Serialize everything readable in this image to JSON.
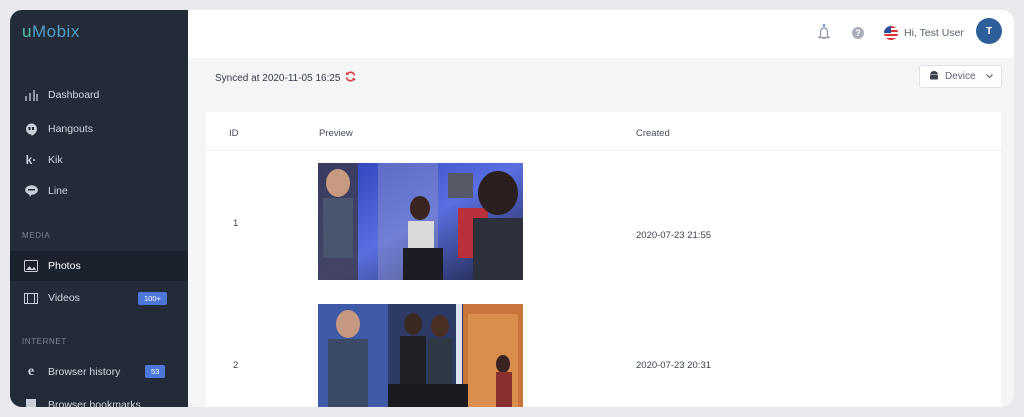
{
  "app": {
    "logo_prefix": "u",
    "logo_rest": "Mobix"
  },
  "sidebar": {
    "items": [
      {
        "label": "Dashboard",
        "icon": "bar-chart-icon"
      },
      {
        "label": "Hangouts",
        "icon": "hangouts-icon"
      },
      {
        "label": "Kik",
        "icon": "kik-icon"
      },
      {
        "label": "Line",
        "icon": "line-icon"
      },
      {
        "label": "Photos",
        "icon": "photos-icon",
        "active": true
      },
      {
        "label": "Videos",
        "icon": "film-icon",
        "badge": "100+"
      },
      {
        "label": "Browser history",
        "icon": "browser-icon",
        "badge": "53"
      },
      {
        "label": "Browser bookmarks",
        "icon": "bookmark-icon"
      }
    ],
    "sections": {
      "media": "MEDIA",
      "internet": "INTERNET"
    }
  },
  "header": {
    "greeting": "Hi, Test User",
    "avatar_initial": "T"
  },
  "sync": {
    "text": "Synced at 2020-11-05 16:25"
  },
  "device_select": {
    "label": "Device"
  },
  "table": {
    "columns": {
      "id": "ID",
      "preview": "Preview",
      "created": "Created"
    },
    "rows": [
      {
        "id": "1",
        "created": "2020-07-23 21:55"
      },
      {
        "id": "2",
        "created": "2020-07-23 20:31"
      }
    ]
  },
  "colors": {
    "accent": "#4f76d9",
    "sidebar_bg": "#232a38",
    "sync_icon": "#d94040"
  }
}
